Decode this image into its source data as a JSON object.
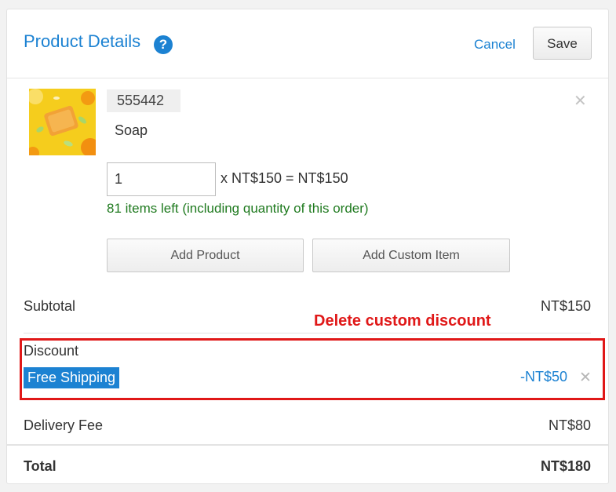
{
  "header": {
    "title": "Product Details",
    "help_glyph": "?",
    "cancel_label": "Cancel",
    "save_label": "Save"
  },
  "product": {
    "sku": "555442",
    "name": "Soap",
    "quantity": "1",
    "price_calc": "x NT$150 = NT$150",
    "stock_note": "81 items left (including quantity of this order)",
    "remove_glyph": "✕"
  },
  "actions": {
    "add_product": "Add Product",
    "add_custom_item": "Add Custom Item"
  },
  "summary": {
    "subtotal_label": "Subtotal",
    "subtotal_value": "NT$150",
    "discount_label": "Discount",
    "discount_name": "Free Shipping",
    "discount_value": "-NT$50",
    "discount_remove_glyph": "✕",
    "delivery_label": "Delivery Fee",
    "delivery_value": "NT$80",
    "total_label": "Total",
    "total_value": "NT$180"
  },
  "annotation": {
    "text": "Delete custom discount",
    "color": "#e01818"
  },
  "colors": {
    "accent": "#1c82d2",
    "stock_green": "#1f7a1f",
    "highlight_red": "#e01818"
  }
}
